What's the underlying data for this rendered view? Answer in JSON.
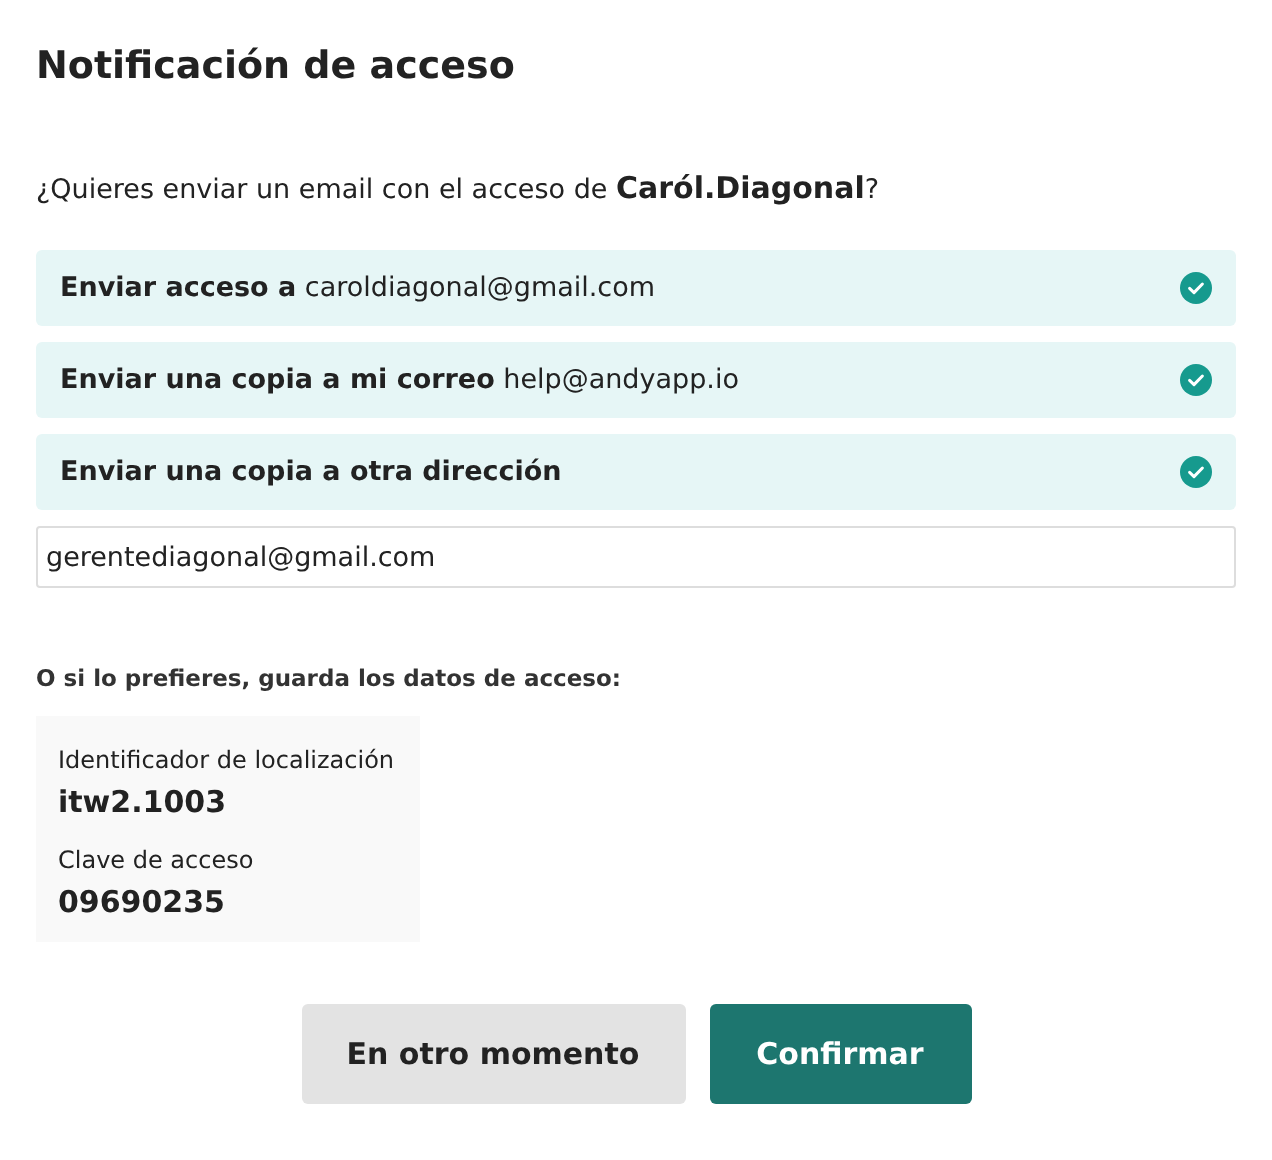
{
  "title": "Notificación de acceso",
  "question": "¿Quieres enviar un email con el acceso de **Caról.Diagonal**?",
  "options": [
    {
      "label": "Enviar acceso a",
      "value": "caroldiagonal@gmail.com",
      "checked": true
    },
    {
      "label": "Enviar una copia a mi correo",
      "value": "help@andyapp.io",
      "checked": true
    },
    {
      "label": "Enviar una copia a otra dirección",
      "checked": true
    }
  ],
  "other_address": {
    "value": "gerentediagonal@gmail.com"
  },
  "save_hint": "O si lo prefieres, guarda los datos de acceso:",
  "credentials": [
    {
      "label": "Identificador de localización",
      "value": "itw2.1003"
    },
    {
      "label": "Clave de acceso",
      "value": "09690235"
    }
  ],
  "buttons": [
    {
      "label": "En otro momento",
      "kind": "secondary"
    },
    {
      "label": "Confirmar",
      "kind": "primary"
    }
  ]
}
